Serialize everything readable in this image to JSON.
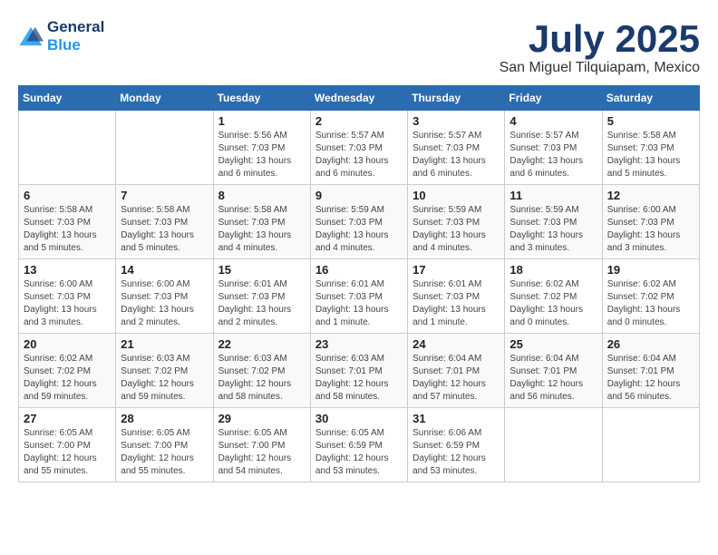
{
  "header": {
    "logo_line1": "General",
    "logo_line2": "Blue",
    "month": "July 2025",
    "location": "San Miguel Tilquiapam, Mexico"
  },
  "weekdays": [
    "Sunday",
    "Monday",
    "Tuesday",
    "Wednesday",
    "Thursday",
    "Friday",
    "Saturday"
  ],
  "weeks": [
    [
      {
        "day": "",
        "info": ""
      },
      {
        "day": "",
        "info": ""
      },
      {
        "day": "1",
        "info": "Sunrise: 5:56 AM\nSunset: 7:03 PM\nDaylight: 13 hours and 6 minutes."
      },
      {
        "day": "2",
        "info": "Sunrise: 5:57 AM\nSunset: 7:03 PM\nDaylight: 13 hours and 6 minutes."
      },
      {
        "day": "3",
        "info": "Sunrise: 5:57 AM\nSunset: 7:03 PM\nDaylight: 13 hours and 6 minutes."
      },
      {
        "day": "4",
        "info": "Sunrise: 5:57 AM\nSunset: 7:03 PM\nDaylight: 13 hours and 6 minutes."
      },
      {
        "day": "5",
        "info": "Sunrise: 5:58 AM\nSunset: 7:03 PM\nDaylight: 13 hours and 5 minutes."
      }
    ],
    [
      {
        "day": "6",
        "info": "Sunrise: 5:58 AM\nSunset: 7:03 PM\nDaylight: 13 hours and 5 minutes."
      },
      {
        "day": "7",
        "info": "Sunrise: 5:58 AM\nSunset: 7:03 PM\nDaylight: 13 hours and 5 minutes."
      },
      {
        "day": "8",
        "info": "Sunrise: 5:58 AM\nSunset: 7:03 PM\nDaylight: 13 hours and 4 minutes."
      },
      {
        "day": "9",
        "info": "Sunrise: 5:59 AM\nSunset: 7:03 PM\nDaylight: 13 hours and 4 minutes."
      },
      {
        "day": "10",
        "info": "Sunrise: 5:59 AM\nSunset: 7:03 PM\nDaylight: 13 hours and 4 minutes."
      },
      {
        "day": "11",
        "info": "Sunrise: 5:59 AM\nSunset: 7:03 PM\nDaylight: 13 hours and 3 minutes."
      },
      {
        "day": "12",
        "info": "Sunrise: 6:00 AM\nSunset: 7:03 PM\nDaylight: 13 hours and 3 minutes."
      }
    ],
    [
      {
        "day": "13",
        "info": "Sunrise: 6:00 AM\nSunset: 7:03 PM\nDaylight: 13 hours and 3 minutes."
      },
      {
        "day": "14",
        "info": "Sunrise: 6:00 AM\nSunset: 7:03 PM\nDaylight: 13 hours and 2 minutes."
      },
      {
        "day": "15",
        "info": "Sunrise: 6:01 AM\nSunset: 7:03 PM\nDaylight: 13 hours and 2 minutes."
      },
      {
        "day": "16",
        "info": "Sunrise: 6:01 AM\nSunset: 7:03 PM\nDaylight: 13 hours and 1 minute."
      },
      {
        "day": "17",
        "info": "Sunrise: 6:01 AM\nSunset: 7:03 PM\nDaylight: 13 hours and 1 minute."
      },
      {
        "day": "18",
        "info": "Sunrise: 6:02 AM\nSunset: 7:02 PM\nDaylight: 13 hours and 0 minutes."
      },
      {
        "day": "19",
        "info": "Sunrise: 6:02 AM\nSunset: 7:02 PM\nDaylight: 13 hours and 0 minutes."
      }
    ],
    [
      {
        "day": "20",
        "info": "Sunrise: 6:02 AM\nSunset: 7:02 PM\nDaylight: 12 hours and 59 minutes."
      },
      {
        "day": "21",
        "info": "Sunrise: 6:03 AM\nSunset: 7:02 PM\nDaylight: 12 hours and 59 minutes."
      },
      {
        "day": "22",
        "info": "Sunrise: 6:03 AM\nSunset: 7:02 PM\nDaylight: 12 hours and 58 minutes."
      },
      {
        "day": "23",
        "info": "Sunrise: 6:03 AM\nSunset: 7:01 PM\nDaylight: 12 hours and 58 minutes."
      },
      {
        "day": "24",
        "info": "Sunrise: 6:04 AM\nSunset: 7:01 PM\nDaylight: 12 hours and 57 minutes."
      },
      {
        "day": "25",
        "info": "Sunrise: 6:04 AM\nSunset: 7:01 PM\nDaylight: 12 hours and 56 minutes."
      },
      {
        "day": "26",
        "info": "Sunrise: 6:04 AM\nSunset: 7:01 PM\nDaylight: 12 hours and 56 minutes."
      }
    ],
    [
      {
        "day": "27",
        "info": "Sunrise: 6:05 AM\nSunset: 7:00 PM\nDaylight: 12 hours and 55 minutes."
      },
      {
        "day": "28",
        "info": "Sunrise: 6:05 AM\nSunset: 7:00 PM\nDaylight: 12 hours and 55 minutes."
      },
      {
        "day": "29",
        "info": "Sunrise: 6:05 AM\nSunset: 7:00 PM\nDaylight: 12 hours and 54 minutes."
      },
      {
        "day": "30",
        "info": "Sunrise: 6:05 AM\nSunset: 6:59 PM\nDaylight: 12 hours and 53 minutes."
      },
      {
        "day": "31",
        "info": "Sunrise: 6:06 AM\nSunset: 6:59 PM\nDaylight: 12 hours and 53 minutes."
      },
      {
        "day": "",
        "info": ""
      },
      {
        "day": "",
        "info": ""
      }
    ]
  ]
}
